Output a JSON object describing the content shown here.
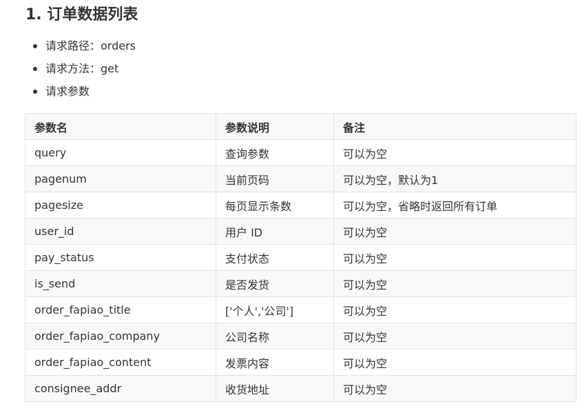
{
  "heading": "1. 订单数据列表",
  "bullets": [
    "请求路径：orders",
    "请求方法：get",
    "请求参数"
  ],
  "table": {
    "headers": [
      "参数名",
      "参数说明",
      "备注"
    ],
    "rows": [
      [
        "query",
        "查询参数",
        "可以为空"
      ],
      [
        "pagenum",
        "当前页码",
        "可以为空，默认为1"
      ],
      [
        "pagesize",
        "每页显示条数",
        "可以为空，省略时返回所有订单"
      ],
      [
        "user_id",
        "用户 ID",
        "可以为空"
      ],
      [
        "pay_status",
        "支付状态",
        "可以为空"
      ],
      [
        "is_send",
        "是否发货",
        "可以为空"
      ],
      [
        "order_fapiao_title",
        "['个人','公司']",
        "可以为空"
      ],
      [
        "order_fapiao_company",
        "公司名称",
        "可以为空"
      ],
      [
        "order_fapiao_content",
        "发票内容",
        "可以为空"
      ],
      [
        "consignee_addr",
        "收货地址",
        "可以为空"
      ]
    ]
  }
}
